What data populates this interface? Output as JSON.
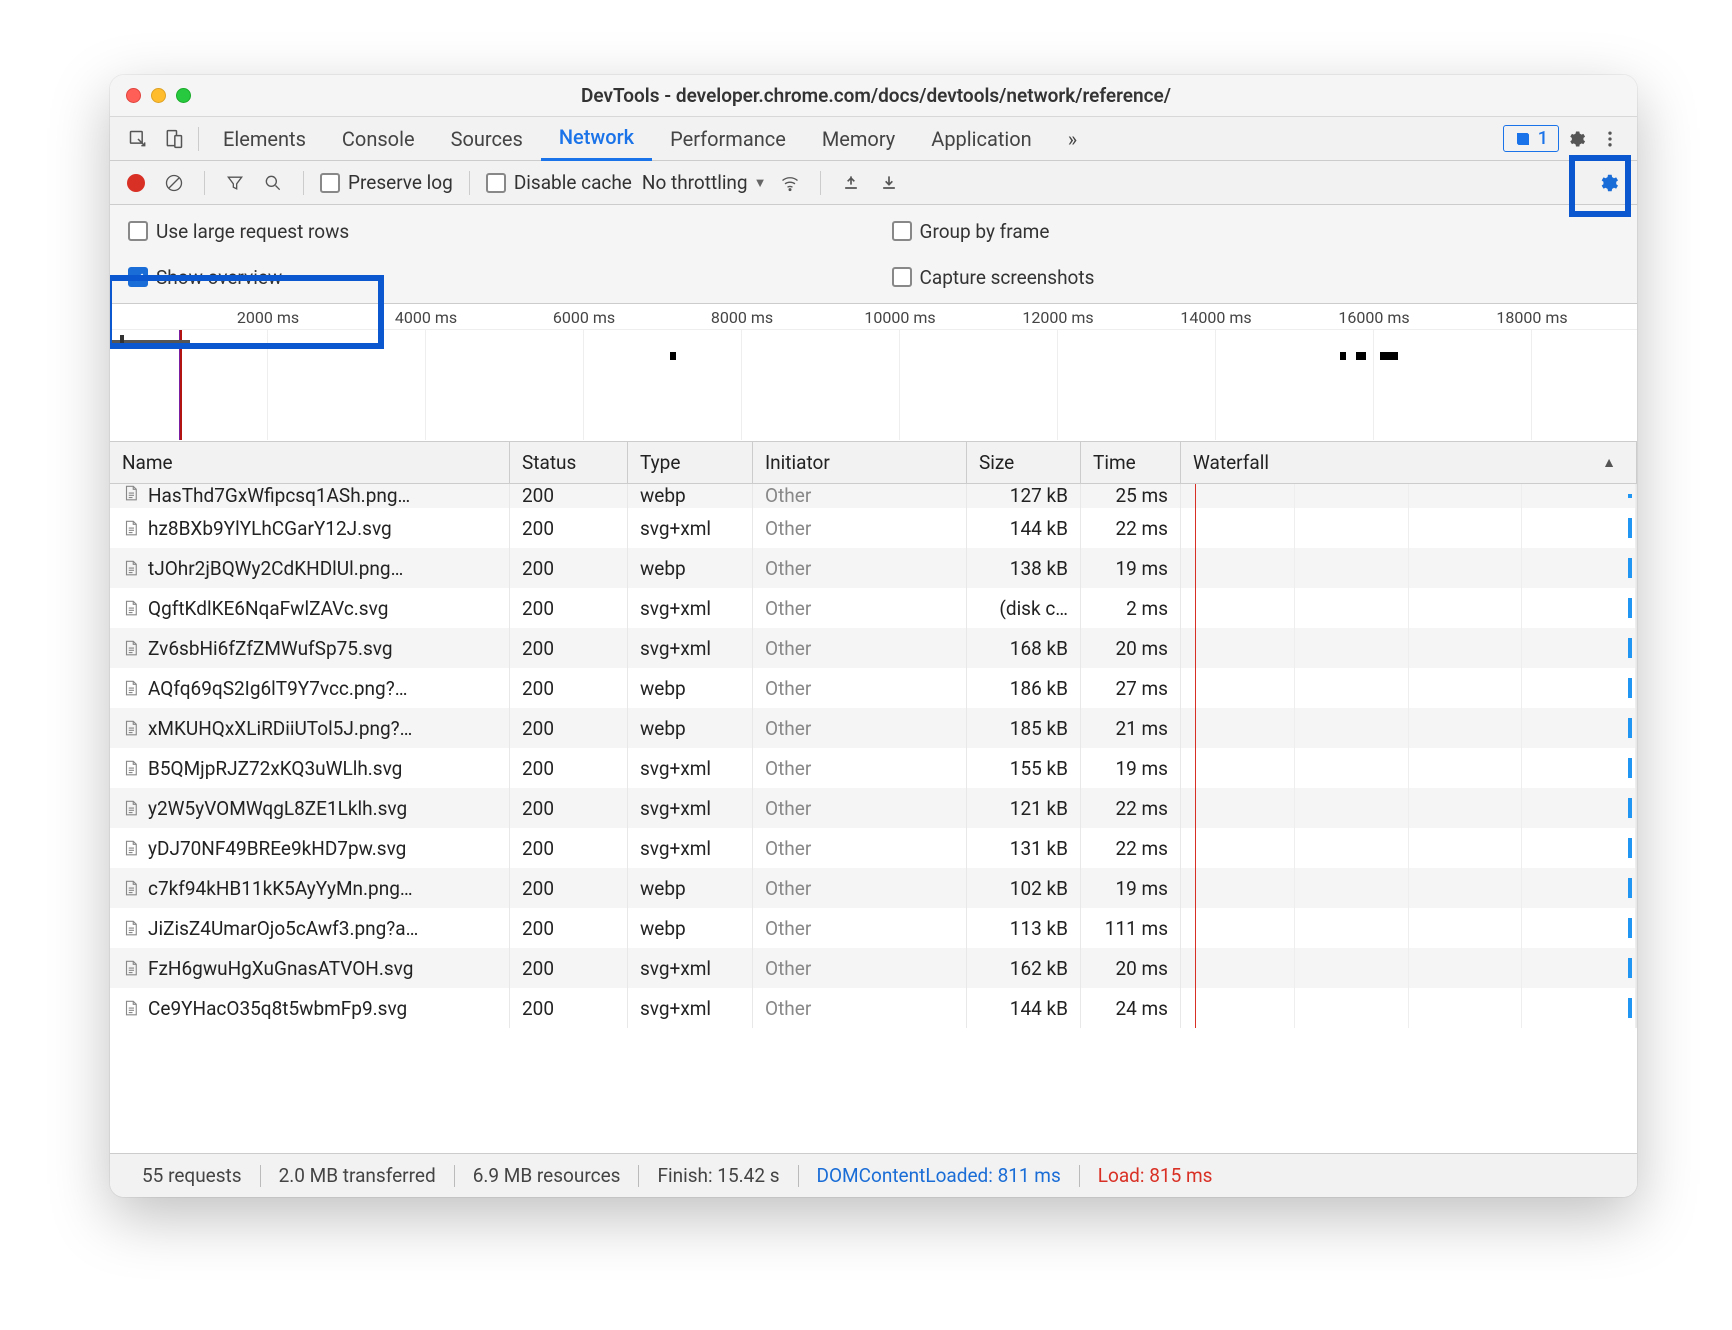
{
  "window_title": "DevTools - developer.chrome.com/docs/devtools/network/reference/",
  "main_tabs": [
    "Elements",
    "Console",
    "Sources",
    "Network",
    "Performance",
    "Memory",
    "Application"
  ],
  "active_tab": "Network",
  "more_indicator": "»",
  "issues_count": "1",
  "toolbar": {
    "preserve_log": "Preserve log",
    "disable_cache": "Disable cache",
    "throttling": "No throttling"
  },
  "settings": {
    "large_rows": "Use large request rows",
    "show_overview": "Show overview",
    "group_by_frame": "Group by frame",
    "capture_screenshots": "Capture screenshots"
  },
  "timeline_ticks": [
    "2000 ms",
    "4000 ms",
    "6000 ms",
    "8000 ms",
    "10000 ms",
    "12000 ms",
    "14000 ms",
    "16000 ms",
    "18000 ms"
  ],
  "columns": {
    "name": "Name",
    "status": "Status",
    "type": "Type",
    "initiator": "Initiator",
    "size": "Size",
    "time": "Time",
    "waterfall": "Waterfall"
  },
  "rows": [
    {
      "name": "HasThd7GxWfipcsq1ASh.png…",
      "status": "200",
      "type": "webp",
      "initiator": "Other",
      "size": "127 kB",
      "time": "25 ms"
    },
    {
      "name": "hz8BXb9YlYLhCGarY12J.svg",
      "status": "200",
      "type": "svg+xml",
      "initiator": "Other",
      "size": "144 kB",
      "time": "22 ms"
    },
    {
      "name": "tJOhr2jBQWy2CdKHDlUl.png…",
      "status": "200",
      "type": "webp",
      "initiator": "Other",
      "size": "138 kB",
      "time": "19 ms"
    },
    {
      "name": "QgftKdlKE6NqaFwlZAVc.svg",
      "status": "200",
      "type": "svg+xml",
      "initiator": "Other",
      "size": "(disk c…",
      "time": "2 ms"
    },
    {
      "name": "Zv6sbHi6fZfZMWufSp75.svg",
      "status": "200",
      "type": "svg+xml",
      "initiator": "Other",
      "size": "168 kB",
      "time": "20 ms"
    },
    {
      "name": "AQfq69qS2Ig6lT9Y7vcc.png?…",
      "status": "200",
      "type": "webp",
      "initiator": "Other",
      "size": "186 kB",
      "time": "27 ms"
    },
    {
      "name": "xMKUHQxXLiRDiiUTol5J.png?…",
      "status": "200",
      "type": "webp",
      "initiator": "Other",
      "size": "185 kB",
      "time": "21 ms"
    },
    {
      "name": "B5QMjpRJZ72xKQ3uWLlh.svg",
      "status": "200",
      "type": "svg+xml",
      "initiator": "Other",
      "size": "155 kB",
      "time": "19 ms"
    },
    {
      "name": "y2W5yVOMWqgL8ZE1Lklh.svg",
      "status": "200",
      "type": "svg+xml",
      "initiator": "Other",
      "size": "121 kB",
      "time": "22 ms"
    },
    {
      "name": "yDJ70NF49BREe9kHD7pw.svg",
      "status": "200",
      "type": "svg+xml",
      "initiator": "Other",
      "size": "131 kB",
      "time": "22 ms"
    },
    {
      "name": "c7kf94kHB11kK5AyYyMn.png…",
      "status": "200",
      "type": "webp",
      "initiator": "Other",
      "size": "102 kB",
      "time": "19 ms"
    },
    {
      "name": "JiZisZ4UmarOjo5cAwf3.png?a…",
      "status": "200",
      "type": "webp",
      "initiator": "Other",
      "size": "113 kB",
      "time": "111 ms"
    },
    {
      "name": "FzH6gwuHgXuGnasATVOH.svg",
      "status": "200",
      "type": "svg+xml",
      "initiator": "Other",
      "size": "162 kB",
      "time": "20 ms"
    },
    {
      "name": "Ce9YHacO35q8t5wbmFp9.svg",
      "status": "200",
      "type": "svg+xml",
      "initiator": "Other",
      "size": "144 kB",
      "time": "24 ms"
    }
  ],
  "statusbar": {
    "requests": "55 requests",
    "transferred": "2.0 MB transferred",
    "resources": "6.9 MB resources",
    "finish": "Finish: 15.42 s",
    "domloaded": "DOMContentLoaded: 811 ms",
    "load": "Load: 815 ms"
  }
}
